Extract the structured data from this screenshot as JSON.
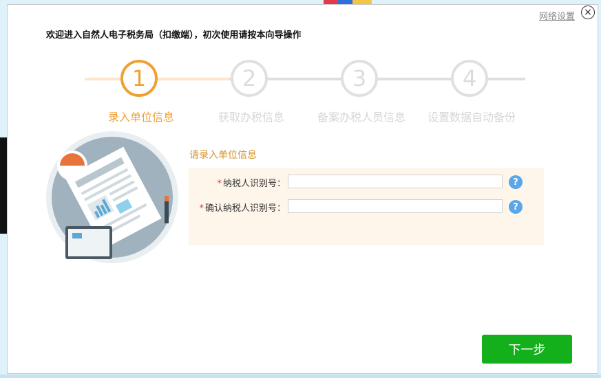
{
  "header": {
    "network_settings": "网络设置",
    "close_symbol": "×",
    "welcome_text": "欢迎进入自然人电子税务局（扣缴端），初次使用请按本向导操作"
  },
  "steps": [
    {
      "number": "1",
      "label": "录入单位信息",
      "state": "active"
    },
    {
      "number": "2",
      "label": "获取办税信息",
      "state": "todo"
    },
    {
      "number": "3",
      "label": "备案办税人员信息",
      "state": "todo"
    },
    {
      "number": "4",
      "label": "设置数据自动备份",
      "state": "todo"
    }
  ],
  "form": {
    "title": "请录入单位信息",
    "fields": [
      {
        "required_mark": "*",
        "label": "纳税人识别号：",
        "value": "",
        "help": "?"
      },
      {
        "required_mark": "*",
        "label": "确认纳税人识别号：",
        "value": "",
        "help": "?"
      }
    ]
  },
  "footer": {
    "next_label": "下一步"
  },
  "colors": {
    "accent": "#f0a033",
    "primary_button": "#14b01c",
    "help_icon": "#5aa6e6"
  }
}
